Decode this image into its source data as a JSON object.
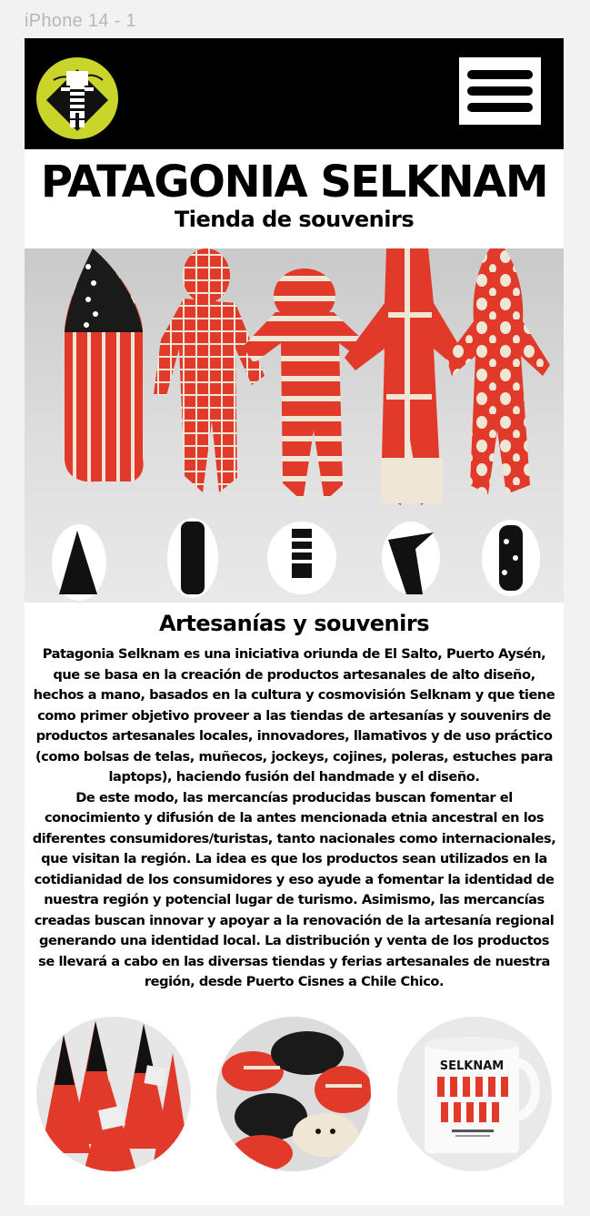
{
  "frame_label": "iPhone 14 - 1",
  "header": {
    "logo_icon": "selknam-spirit-logo-icon",
    "menu_icon": "hamburger-menu-icon",
    "logo_color": "#c9d52b",
    "background": "#000000"
  },
  "hero": {
    "title": "PATAGONIA SELKNAM",
    "subtitle": "Tienda de souvenirs",
    "doll_color": "#e23a2a",
    "cream_color": "#efe6d6"
  },
  "about": {
    "heading": "Artesanías y souvenirs",
    "paragraph_1": "Patagonia Selknam es una iniciativa oriunda de El Salto, Puerto Aysén, que se basa en la creación de productos artesanales de alto diseño, hechos a mano, basados en la cultura y cosmovisión Selknam y que tiene como primer objetivo proveer a las tiendas de artesanías y souvenirs de productos artesanales locales, innovadores, llamativos y de uso práctico (como bolsas de telas, muñecos, jockeys, cojines, poleras, estuches para laptops), haciendo fusión del handmade y el diseño.",
    "paragraph_2": "De este modo, las mercancías producidas buscan fomentar el conocimiento y difusión de la antes mencionada etnia ancestral en los diferentes consumidores/turistas, tanto nacionales como internacionales, que visitan la región. La idea es que los productos sean utilizados en la cotidianidad de los consumidores y eso ayude a fomentar la identidad de nuestra región y potencial lugar de turismo. Asimismo, las mercancías creadas buscan innovar y apoyar a la renovación de la artesanía regional generando una identidad local. La distribución y venta de los productos se llevará a cabo en las diversas tiendas y ferias artesanales de nuestra región, desde Puerto Cisnes a Chile Chico."
  },
  "gallery": {
    "mug_text": "SELKNAM"
  }
}
